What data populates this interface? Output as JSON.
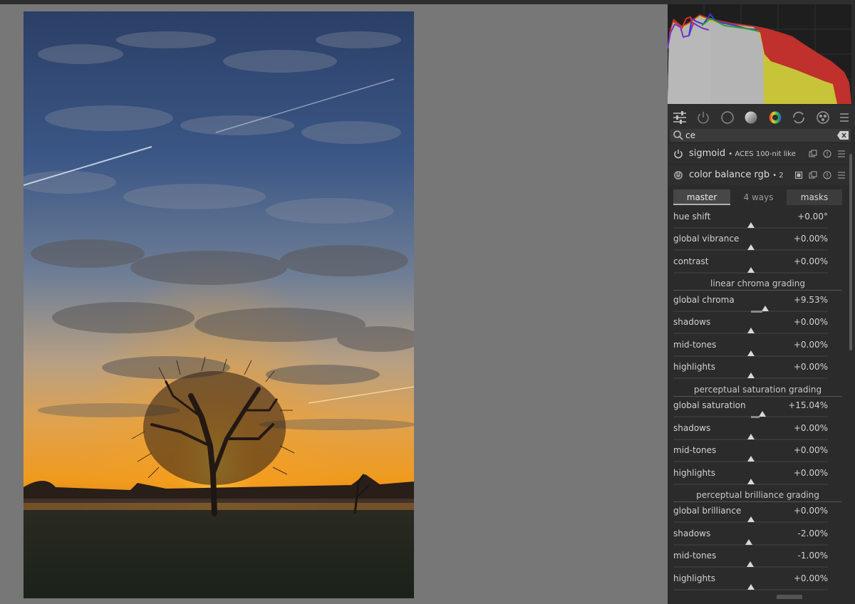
{
  "search": {
    "value": "ce",
    "placeholder": ""
  },
  "modules": {
    "sigmoid": {
      "name": "sigmoid",
      "preset": "• ACES 100-nit like"
    },
    "color_balance": {
      "name": "color balance rgb",
      "instance": "• 2"
    }
  },
  "tabs": [
    {
      "label": "master",
      "active": true
    },
    {
      "label": "4 ways",
      "active": false
    },
    {
      "label": "masks",
      "active": false
    }
  ],
  "sections": {
    "linear_chroma": "linear chroma grading",
    "perceptual_saturation": "perceptual saturation grading",
    "perceptual_brilliance": "perceptual brilliance grading"
  },
  "sliders": [
    {
      "label": "hue shift",
      "value": "+0.00°",
      "level": 0.0
    },
    {
      "label": "global vibrance",
      "value": "+0.00%",
      "level": 0.0
    },
    {
      "label": "contrast",
      "value": "+0.00%",
      "level": 0.0
    },
    {
      "label": "global chroma",
      "value": "+9.53%",
      "level": 9.53
    },
    {
      "label": "shadows",
      "value": "+0.00%",
      "level": 0.0
    },
    {
      "label": "mid-tones",
      "value": "+0.00%",
      "level": 0.0
    },
    {
      "label": "highlights",
      "value": "+0.00%",
      "level": 0.0
    },
    {
      "label": "global saturation",
      "value": "+15.04%",
      "level": 15.04
    },
    {
      "label": "shadows",
      "value": "+0.00%",
      "level": 0.0
    },
    {
      "label": "mid-tones",
      "value": "+0.00%",
      "level": 0.0
    },
    {
      "label": "highlights",
      "value": "+0.00%",
      "level": 0.0
    },
    {
      "label": "global brilliance",
      "value": "+0.00%",
      "level": 0.0
    },
    {
      "label": "shadows",
      "value": "-2.00%",
      "level": -2.0
    },
    {
      "label": "mid-tones",
      "value": "-1.00%",
      "level": -1.0
    },
    {
      "label": "highlights",
      "value": "+0.00%",
      "level": 0.0
    }
  ],
  "module_group_icons": [
    "sliders-icon",
    "power-icon",
    "circle-icon",
    "gradient-circle-icon",
    "color-wheel-icon",
    "rotate-icon",
    "effects-icon",
    "menu-icon"
  ],
  "colors": {
    "panel_bg": "#2b2b2b",
    "canvas_bg": "#777777",
    "histogram_red": "#c0302c",
    "histogram_yellow": "#c8c43a",
    "histogram_blue": "#3a3ad0"
  }
}
